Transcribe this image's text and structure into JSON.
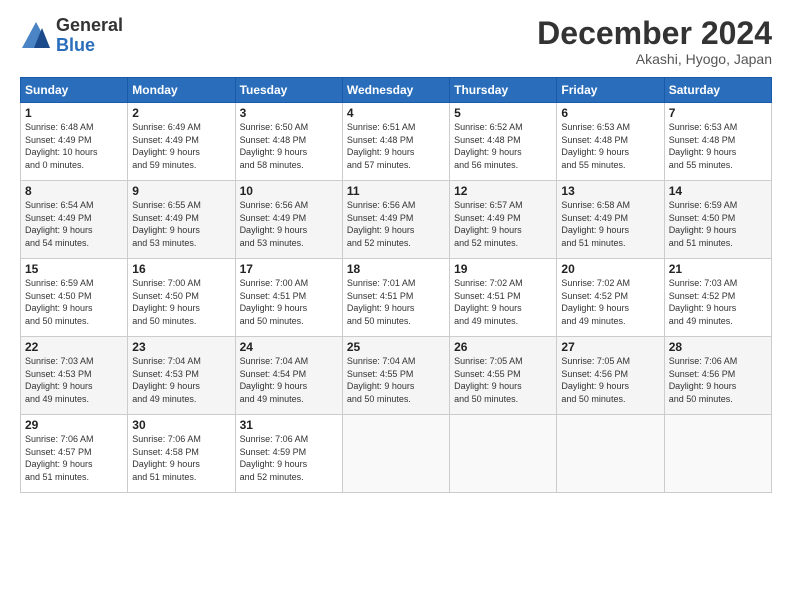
{
  "logo": {
    "general": "General",
    "blue": "Blue"
  },
  "title": "December 2024",
  "location": "Akashi, Hyogo, Japan",
  "headers": [
    "Sunday",
    "Monday",
    "Tuesday",
    "Wednesday",
    "Thursday",
    "Friday",
    "Saturday"
  ],
  "weeks": [
    [
      {
        "day": "1",
        "sunrise": "Sunrise: 6:48 AM",
        "sunset": "Sunset: 4:49 PM",
        "daylight": "Daylight: 10 hours and 0 minutes."
      },
      {
        "day": "2",
        "sunrise": "Sunrise: 6:49 AM",
        "sunset": "Sunset: 4:49 PM",
        "daylight": "Daylight: 9 hours and 59 minutes."
      },
      {
        "day": "3",
        "sunrise": "Sunrise: 6:50 AM",
        "sunset": "Sunset: 4:48 PM",
        "daylight": "Daylight: 9 hours and 58 minutes."
      },
      {
        "day": "4",
        "sunrise": "Sunrise: 6:51 AM",
        "sunset": "Sunset: 4:48 PM",
        "daylight": "Daylight: 9 hours and 57 minutes."
      },
      {
        "day": "5",
        "sunrise": "Sunrise: 6:52 AM",
        "sunset": "Sunset: 4:48 PM",
        "daylight": "Daylight: 9 hours and 56 minutes."
      },
      {
        "day": "6",
        "sunrise": "Sunrise: 6:53 AM",
        "sunset": "Sunset: 4:48 PM",
        "daylight": "Daylight: 9 hours and 55 minutes."
      },
      {
        "day": "7",
        "sunrise": "Sunrise: 6:53 AM",
        "sunset": "Sunset: 4:48 PM",
        "daylight": "Daylight: 9 hours and 55 minutes."
      }
    ],
    [
      {
        "day": "8",
        "sunrise": "Sunrise: 6:54 AM",
        "sunset": "Sunset: 4:49 PM",
        "daylight": "Daylight: 9 hours and 54 minutes."
      },
      {
        "day": "9",
        "sunrise": "Sunrise: 6:55 AM",
        "sunset": "Sunset: 4:49 PM",
        "daylight": "Daylight: 9 hours and 53 minutes."
      },
      {
        "day": "10",
        "sunrise": "Sunrise: 6:56 AM",
        "sunset": "Sunset: 4:49 PM",
        "daylight": "Daylight: 9 hours and 53 minutes."
      },
      {
        "day": "11",
        "sunrise": "Sunrise: 6:56 AM",
        "sunset": "Sunset: 4:49 PM",
        "daylight": "Daylight: 9 hours and 52 minutes."
      },
      {
        "day": "12",
        "sunrise": "Sunrise: 6:57 AM",
        "sunset": "Sunset: 4:49 PM",
        "daylight": "Daylight: 9 hours and 52 minutes."
      },
      {
        "day": "13",
        "sunrise": "Sunrise: 6:58 AM",
        "sunset": "Sunset: 4:49 PM",
        "daylight": "Daylight: 9 hours and 51 minutes."
      },
      {
        "day": "14",
        "sunrise": "Sunrise: 6:59 AM",
        "sunset": "Sunset: 4:50 PM",
        "daylight": "Daylight: 9 hours and 51 minutes."
      }
    ],
    [
      {
        "day": "15",
        "sunrise": "Sunrise: 6:59 AM",
        "sunset": "Sunset: 4:50 PM",
        "daylight": "Daylight: 9 hours and 50 minutes."
      },
      {
        "day": "16",
        "sunrise": "Sunrise: 7:00 AM",
        "sunset": "Sunset: 4:50 PM",
        "daylight": "Daylight: 9 hours and 50 minutes."
      },
      {
        "day": "17",
        "sunrise": "Sunrise: 7:00 AM",
        "sunset": "Sunset: 4:51 PM",
        "daylight": "Daylight: 9 hours and 50 minutes."
      },
      {
        "day": "18",
        "sunrise": "Sunrise: 7:01 AM",
        "sunset": "Sunset: 4:51 PM",
        "daylight": "Daylight: 9 hours and 50 minutes."
      },
      {
        "day": "19",
        "sunrise": "Sunrise: 7:02 AM",
        "sunset": "Sunset: 4:51 PM",
        "daylight": "Daylight: 9 hours and 49 minutes."
      },
      {
        "day": "20",
        "sunrise": "Sunrise: 7:02 AM",
        "sunset": "Sunset: 4:52 PM",
        "daylight": "Daylight: 9 hours and 49 minutes."
      },
      {
        "day": "21",
        "sunrise": "Sunrise: 7:03 AM",
        "sunset": "Sunset: 4:52 PM",
        "daylight": "Daylight: 9 hours and 49 minutes."
      }
    ],
    [
      {
        "day": "22",
        "sunrise": "Sunrise: 7:03 AM",
        "sunset": "Sunset: 4:53 PM",
        "daylight": "Daylight: 9 hours and 49 minutes."
      },
      {
        "day": "23",
        "sunrise": "Sunrise: 7:04 AM",
        "sunset": "Sunset: 4:53 PM",
        "daylight": "Daylight: 9 hours and 49 minutes."
      },
      {
        "day": "24",
        "sunrise": "Sunrise: 7:04 AM",
        "sunset": "Sunset: 4:54 PM",
        "daylight": "Daylight: 9 hours and 49 minutes."
      },
      {
        "day": "25",
        "sunrise": "Sunrise: 7:04 AM",
        "sunset": "Sunset: 4:55 PM",
        "daylight": "Daylight: 9 hours and 50 minutes."
      },
      {
        "day": "26",
        "sunrise": "Sunrise: 7:05 AM",
        "sunset": "Sunset: 4:55 PM",
        "daylight": "Daylight: 9 hours and 50 minutes."
      },
      {
        "day": "27",
        "sunrise": "Sunrise: 7:05 AM",
        "sunset": "Sunset: 4:56 PM",
        "daylight": "Daylight: 9 hours and 50 minutes."
      },
      {
        "day": "28",
        "sunrise": "Sunrise: 7:06 AM",
        "sunset": "Sunset: 4:56 PM",
        "daylight": "Daylight: 9 hours and 50 minutes."
      }
    ],
    [
      {
        "day": "29",
        "sunrise": "Sunrise: 7:06 AM",
        "sunset": "Sunset: 4:57 PM",
        "daylight": "Daylight: 9 hours and 51 minutes."
      },
      {
        "day": "30",
        "sunrise": "Sunrise: 7:06 AM",
        "sunset": "Sunset: 4:58 PM",
        "daylight": "Daylight: 9 hours and 51 minutes."
      },
      {
        "day": "31",
        "sunrise": "Sunrise: 7:06 AM",
        "sunset": "Sunset: 4:59 PM",
        "daylight": "Daylight: 9 hours and 52 minutes."
      },
      null,
      null,
      null,
      null
    ]
  ]
}
